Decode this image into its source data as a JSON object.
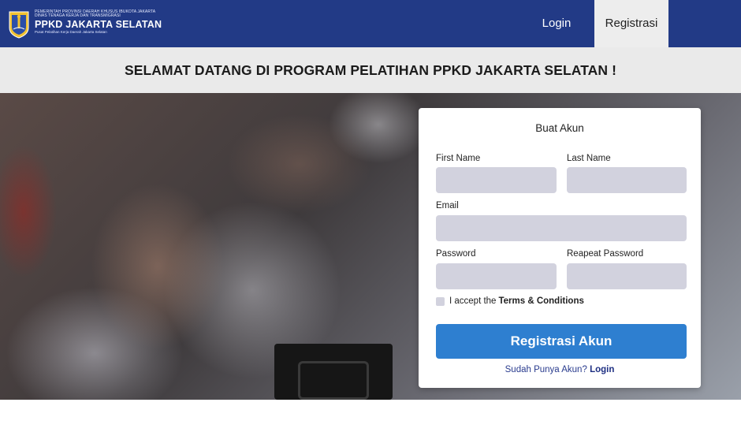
{
  "header": {
    "brand_line1": "PEMERINTAH PROVINSI DAERAH KHUSUS IBUKOTA JAKARTA",
    "brand_line2": "DINAS TENAGA KERJA DAN TRANSMIGRASI",
    "brand_title": "PPKD JAKARTA SELATAN",
    "brand_sub": "Pusat Pelatihan Kerja Daerah Jakarta Selatan",
    "nav_login": "Login",
    "nav_register": "Registrasi"
  },
  "welcome": {
    "text": "SELAMAT DATANG DI PROGRAM PELATIHAN PPKD JAKARTA SELATAN !"
  },
  "form": {
    "title": "Buat Akun",
    "first_name_label": "First Name",
    "last_name_label": "Last Name",
    "email_label": "Email",
    "password_label": "Password",
    "repeat_password_label": "Reapeat Password",
    "accept_text": "I accept the",
    "terms_text": "Terms & Conditions",
    "submit_label": "Registrasi Akun",
    "have_account_text": "Sudah Punya Akun?",
    "login_link": "Login"
  },
  "colors": {
    "navbar": "#223a86",
    "accent_button": "#2e7fd0",
    "input_fill": "#d2d2de"
  },
  "icons": {
    "logo": "jakarta-crest-icon"
  }
}
